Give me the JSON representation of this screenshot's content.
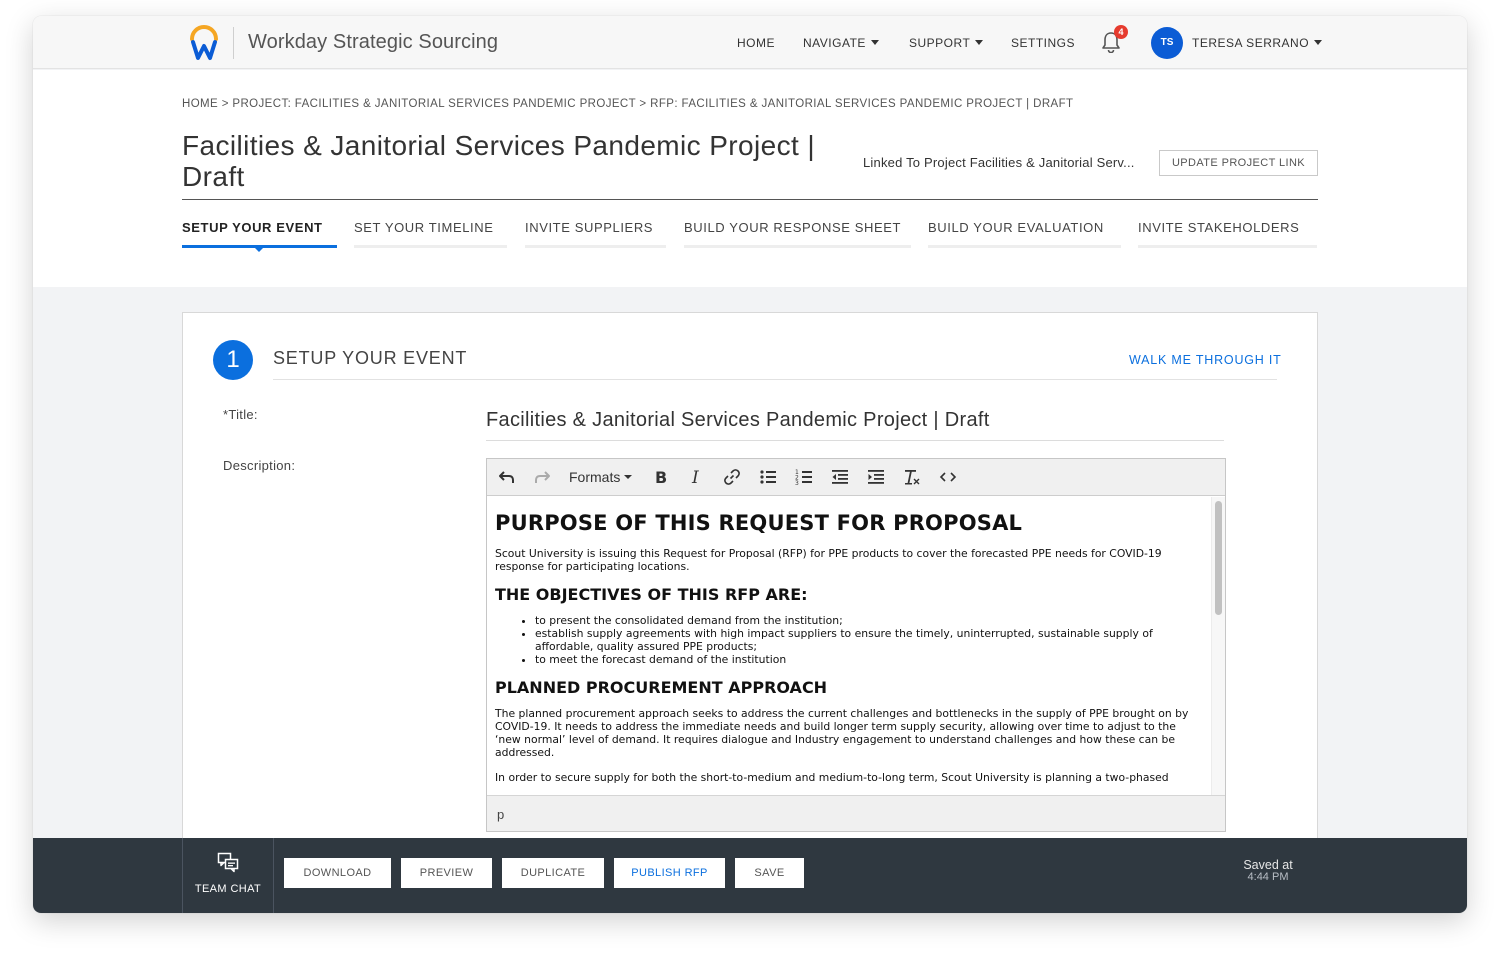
{
  "app": {
    "name": "Workday Strategic Sourcing"
  },
  "nav": {
    "home": "HOME",
    "navigate": "NAVIGATE",
    "support": "SUPPORT",
    "settings": "SETTINGS",
    "notification_count": "4",
    "user_initials": "TS",
    "user_name": "TERESA SERRANO"
  },
  "header": {
    "breadcrumb": "HOME > PROJECT: FACILITIES & JANITORIAL SERVICES PANDEMIC PROJECT > RFP: FACILITIES & JANITORIAL SERVICES PANDEMIC PROJECT | DRAFT",
    "title": "Facilities & Janitorial Services Pandemic Project | Draft",
    "linked_text": "Linked To Project Facilities & Janitorial Serv...",
    "update_link_label": "UPDATE PROJECT LINK"
  },
  "tabs": [
    {
      "label": "SETUP YOUR EVENT"
    },
    {
      "label": "SET YOUR TIMELINE"
    },
    {
      "label": "INVITE SUPPLIERS"
    },
    {
      "label": "BUILD YOUR RESPONSE SHEET"
    },
    {
      "label": "BUILD YOUR EVALUATION"
    },
    {
      "label": "INVITE STAKEHOLDERS"
    }
  ],
  "section": {
    "step_number": "1",
    "title": "SETUP YOUR EVENT",
    "walk_link": "WALK ME THROUGH IT",
    "title_label": "*Title:",
    "title_value": "Facilities & Janitorial Services Pandemic Project | Draft",
    "description_label": "Description:"
  },
  "editor": {
    "formats_label": "Formats",
    "h1": "PURPOSE OF THIS REQUEST FOR PROPOSAL",
    "p1": "Scout University is issuing this Request for Proposal (RFP) for PPE products to cover the forecasted PPE needs for COVID-19 response for participating locations.",
    "h2a": "THE OBJECTIVES OF THIS RFP ARE:",
    "bullets": [
      "to present the consolidated demand from the institution;",
      "establish supply agreements with high impact suppliers to ensure the timely, uninterrupted, sustainable supply of affordable, quality assured PPE products;",
      "to meet the forecast demand of the institution"
    ],
    "h2b": "PLANNED PROCUREMENT APPROACH",
    "p2": "The planned procurement approach seeks to address the current challenges and bottlenecks in the supply of PPE brought on by COVID-19. It needs to address the immediate needs and build longer term supply security, allowing over time to adjust to the ‘new normal’ level of demand. It requires dialogue and Industry engagement to understand challenges and how these can be addressed.",
    "p3": "In order to secure supply for both the short-to-medium and medium-to-long term, Scout University is planning a two-phased",
    "status_path": "p"
  },
  "bottom": {
    "team_chat": "TEAM CHAT",
    "download": "DOWNLOAD",
    "preview": "PREVIEW",
    "duplicate": "DUPLICATE",
    "publish": "PUBLISH RFP",
    "save": "SAVE",
    "saved_at": "Saved at",
    "saved_time": "4:44 PM"
  },
  "colors": {
    "accent": "#0b6fde",
    "avatar": "#0b5cd5",
    "badge": "#e63b2e",
    "bottom_bar": "#2f3840"
  },
  "icons": {
    "logo": "workday-logo-icon",
    "bell": "bell-icon",
    "chat": "chat-icon"
  }
}
